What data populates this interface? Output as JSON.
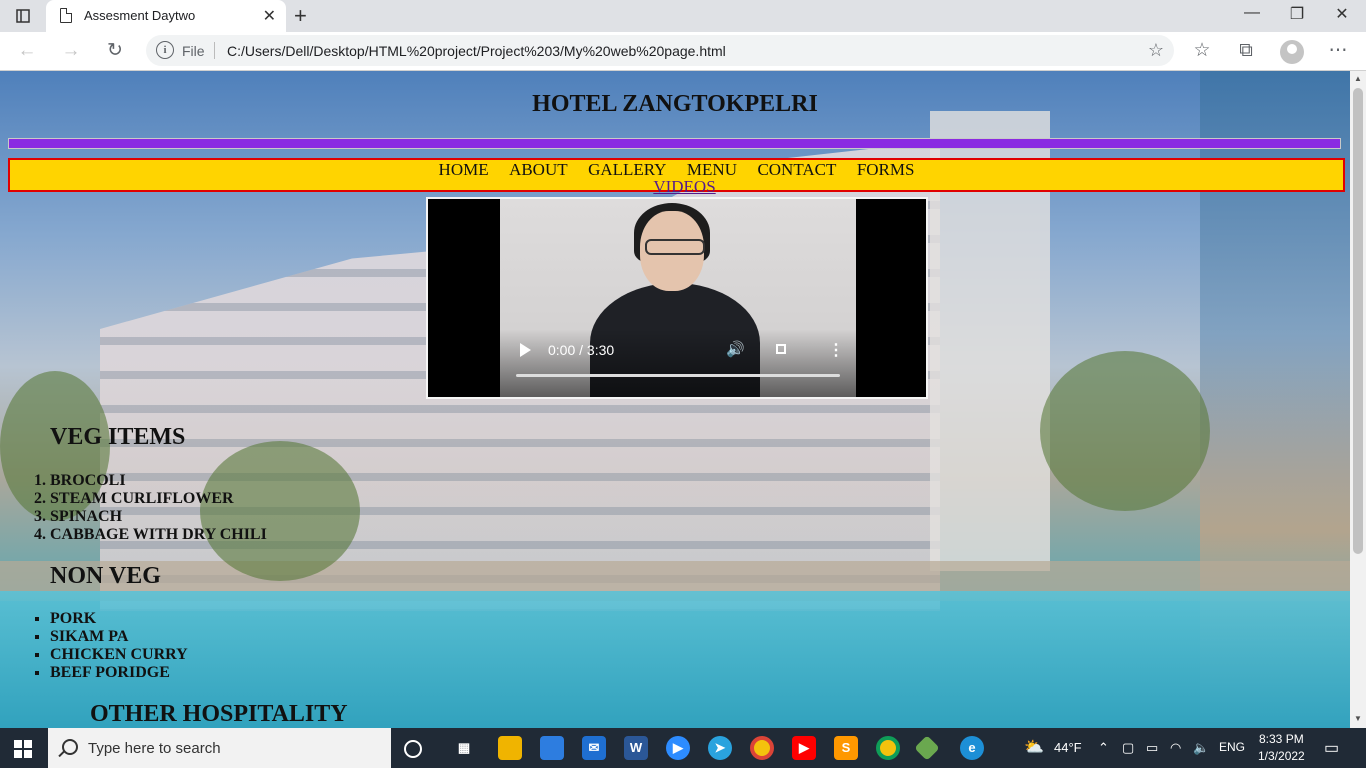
{
  "browser": {
    "tab_title": "Assesment Daytwo",
    "scheme_label": "File",
    "url": "C:/Users/Dell/Desktop/HTML%20project/Project%203/My%20web%20page.html"
  },
  "page": {
    "title": "HOTEL ZANGTOKPELRI",
    "nav": [
      "HOME",
      "ABOUT",
      "GALLERY",
      "MENU",
      "CONTACT",
      "FORMS"
    ],
    "nav_second": "VIDEOS",
    "video": {
      "time": "0:00 / 3:30"
    },
    "veg_heading": "VEG ITEMS",
    "veg_items": [
      "BROCOLI",
      "STEAM CURLIFLOWER",
      "SPINACH",
      "CABBAGE WITH DRY CHILI"
    ],
    "nonveg_heading": "NON VEG",
    "nonveg_items": [
      "PORK",
      "SIKAM PA",
      "CHICKEN CURRY",
      "BEEF PORIDGE"
    ],
    "other_heading": "OTHER HOSPITALITY"
  },
  "taskbar": {
    "search_placeholder": "Type here to search",
    "weather": "44°F",
    "language": "ENG",
    "time": "8:33 PM",
    "date": "1/3/2022"
  }
}
